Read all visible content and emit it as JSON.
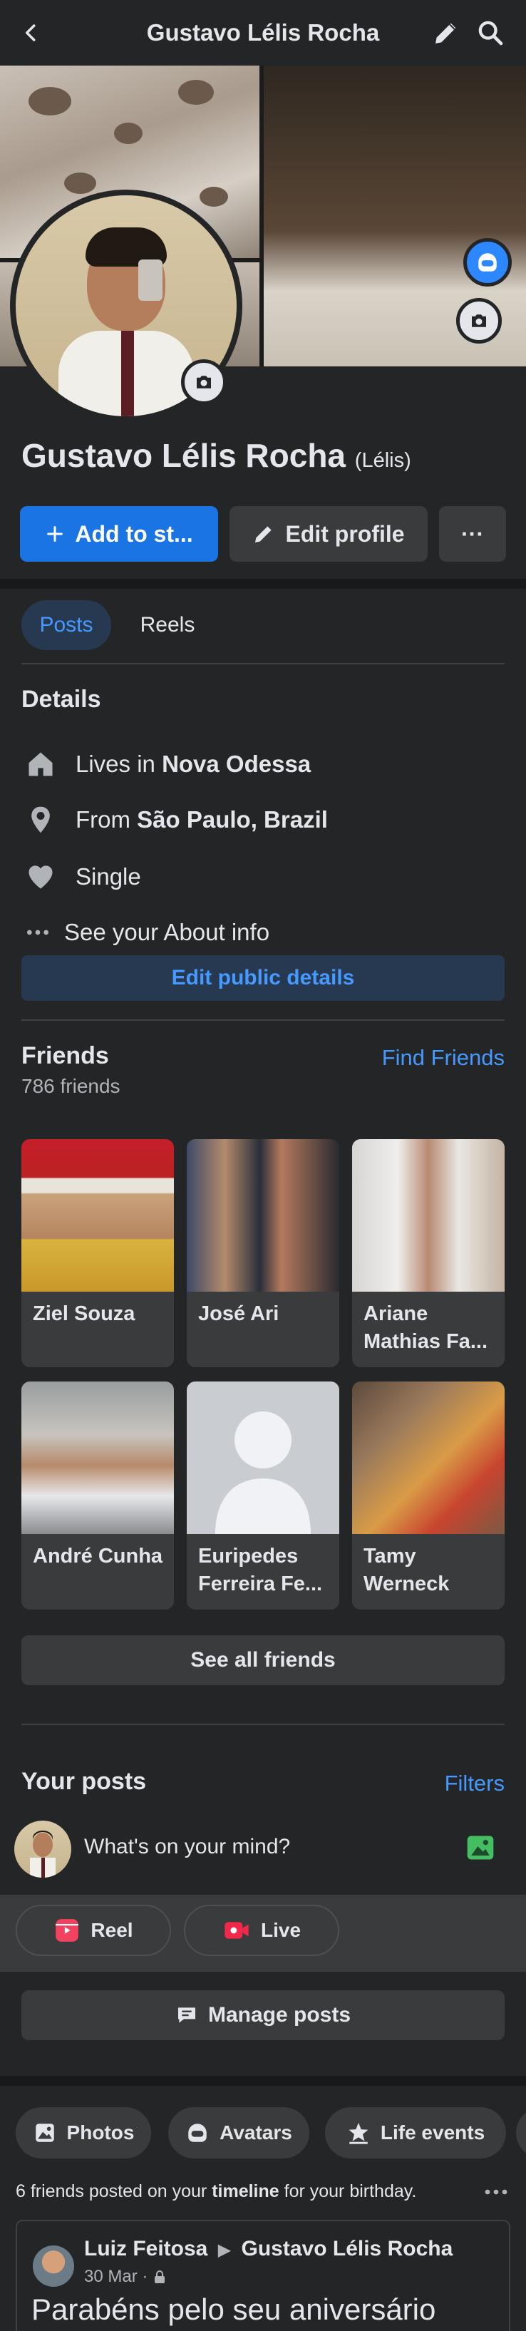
{
  "header": {
    "title": "Gustavo Lélis Rocha"
  },
  "profile": {
    "name": "Gustavo Lélis Rocha",
    "nickname": "(Lélis)"
  },
  "actions": {
    "add_story": "Add to st...",
    "edit_profile": "Edit profile",
    "more": "···"
  },
  "tabs": [
    {
      "label": "Posts",
      "active": true
    },
    {
      "label": "Reels",
      "active": false
    }
  ],
  "details": {
    "title": "Details",
    "lives_prefix": "Lives in",
    "lives_value": "Nova Odessa",
    "from_prefix": "From",
    "from_value": "São Paulo, Brazil",
    "relationship": "Single",
    "about": "See your About info",
    "edit_public": "Edit public details"
  },
  "friends": {
    "title": "Friends",
    "count": "786 friends",
    "find_link": "Find Friends",
    "items": [
      {
        "name": "Ziel Souza"
      },
      {
        "name": "José Ari"
      },
      {
        "name": "Ariane Mathias Fa..."
      },
      {
        "name": "André Cunha"
      },
      {
        "name": "Euripedes Ferreira Fe..."
      },
      {
        "name": "Tamy Werneck"
      }
    ],
    "see_all": "See all friends"
  },
  "your_posts": {
    "title": "Your posts",
    "filters": "Filters",
    "composer_placeholder": "What's on your mind?",
    "reel": "Reel",
    "live": "Live",
    "manage": "Manage posts"
  },
  "chips": [
    {
      "label": "Photos"
    },
    {
      "label": "Avatars"
    },
    {
      "label": "Life events"
    }
  ],
  "birthday": {
    "prefix": "6 friends posted on your",
    "bold": "timeline",
    "suffix": "for your birthday."
  },
  "post": {
    "author": "Luiz Feitosa",
    "target": "Gustavo Lélis Rocha",
    "date": "30 Mar ·",
    "text": "Parabéns pelo seu aniversário"
  },
  "colors": {
    "accent": "#1b74e4",
    "link": "#4599ff",
    "background": "#242526",
    "surface": "#3a3b3c"
  }
}
